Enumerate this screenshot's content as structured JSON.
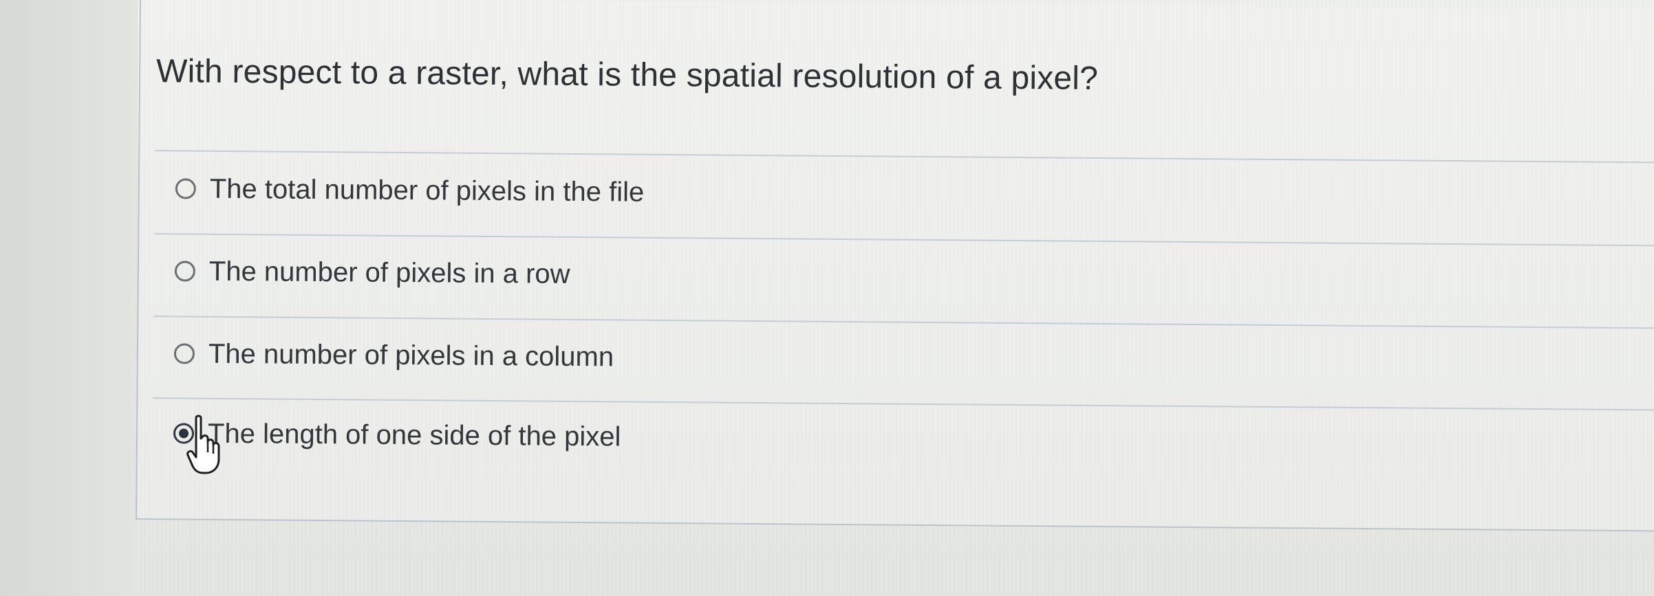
{
  "question": {
    "text": "With respect to a raster, what is the spatial resolution of a pixel?"
  },
  "options": [
    {
      "label": "The total number of pixels in the file",
      "selected": false
    },
    {
      "label": "The number of pixels in a row",
      "selected": false
    },
    {
      "label": "The number of pixels in a column",
      "selected": false
    },
    {
      "label": "The length of one side of the pixel",
      "selected": true
    }
  ],
  "cursor": {
    "icon": "hand-pointer-icon"
  },
  "colors": {
    "background": "#e9ebe7",
    "text": "#33373c",
    "divider": "#c4cdd6",
    "radio_selected": "#2a3440"
  }
}
